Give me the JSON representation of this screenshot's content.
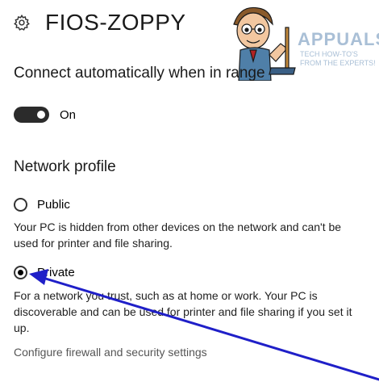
{
  "header": {
    "title": "FIOS-ZOPPY",
    "icon": "gear-icon"
  },
  "auto_connect": {
    "heading": "Connect automatically when in range",
    "toggle_state": "On",
    "toggle_on": true
  },
  "network_profile": {
    "heading": "Network profile",
    "options": [
      {
        "label": "Public",
        "selected": false,
        "description": "Your PC is hidden from other devices on the network and can't be used for printer and file sharing."
      },
      {
        "label": "Private",
        "selected": true,
        "description": "For a network you trust, such as at home or work. Your PC is discoverable and can be used for printer and file sharing if you set it up."
      }
    ]
  },
  "firewall_link": "Configure firewall and security settings",
  "watermark": {
    "name": "APPUALS",
    "tagline": "TECH HOW-TO'S FROM THE EXPERTS!"
  },
  "colors": {
    "toggle_track": "#2b2b2b",
    "arrow": "#1f1fc8",
    "watermark": "#a9bfd6",
    "link": "#555555"
  }
}
